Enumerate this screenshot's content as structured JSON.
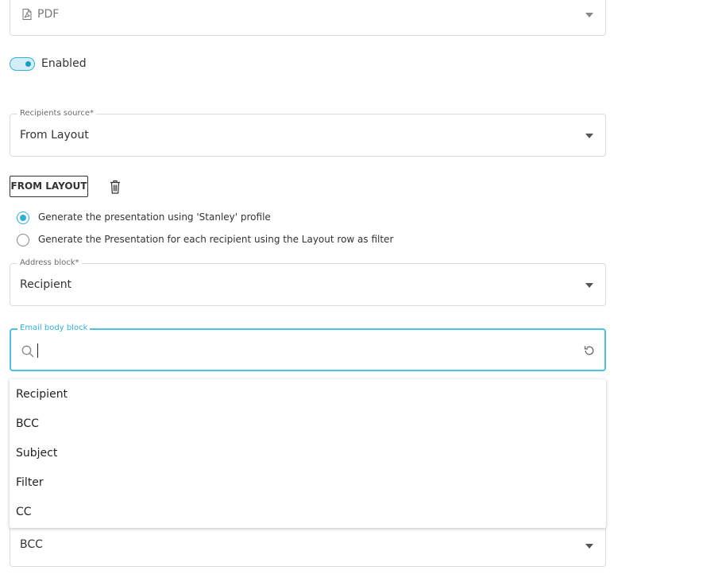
{
  "format_field": {
    "value": "PDF",
    "icon": "pdf-file-icon"
  },
  "enabled_toggle": {
    "label": "Enabled",
    "on": true
  },
  "recipients_source": {
    "label": "Recipients source*",
    "value": "From Layout"
  },
  "source_chip": {
    "label": "FROM LAYOUT",
    "delete_icon": "trash-icon"
  },
  "generation_options": [
    {
      "label": "Generate the presentation using 'Stanley' profile",
      "checked": true
    },
    {
      "label": "Generate the Presentation for each recipient using the Layout row as filter",
      "checked": false
    }
  ],
  "address_block": {
    "label": "Address block*",
    "value": "Recipient"
  },
  "email_body_block": {
    "label": "Email body block",
    "search_value": "",
    "search_icon": "search-icon",
    "reset_icon": "reset-icon"
  },
  "dropdown_options": [
    "Recipient",
    "BCC",
    "Subject",
    "Filter",
    "CC"
  ],
  "next_field": {
    "value": "BCC"
  },
  "colors": {
    "accent": "#2db1d6"
  }
}
